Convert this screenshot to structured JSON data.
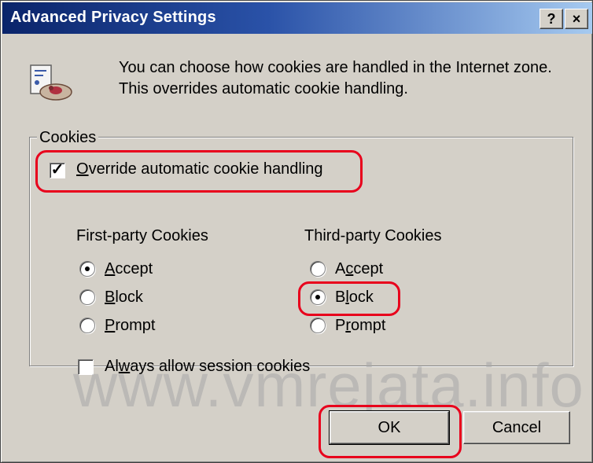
{
  "window": {
    "title": "Advanced Privacy Settings",
    "help_label": "?",
    "close_label": "×"
  },
  "info": {
    "icon": "privacy-cookie-icon",
    "text": "You can choose how cookies are handled in the Internet zone.  This overrides automatic cookie handling."
  },
  "cookies": {
    "legend": "Cookies",
    "override": {
      "label_first": "O",
      "label_rest": "verride automatic cookie handling",
      "checked": true
    },
    "first_party": {
      "heading": "First-party Cookies",
      "options": [
        {
          "pre": "",
          "key": "A",
          "post": "ccept",
          "selected": true
        },
        {
          "pre": "",
          "key": "B",
          "post": "lock",
          "selected": false
        },
        {
          "pre": "",
          "key": "P",
          "post": "rompt",
          "selected": false
        }
      ]
    },
    "third_party": {
      "heading": "Third-party Cookies",
      "options": [
        {
          "pre": "A",
          "key": "c",
          "post": "cept",
          "selected": false
        },
        {
          "pre": "B",
          "key": "l",
          "post": "ock",
          "selected": true
        },
        {
          "pre": "P",
          "key": "r",
          "post": "ompt",
          "selected": false
        }
      ]
    },
    "session": {
      "pre": "Al",
      "key": "w",
      "post": "ays allow session cookies",
      "checked": false
    }
  },
  "buttons": {
    "ok": "OK",
    "cancel": "Cancel"
  },
  "watermark": "www.vmrejata.info",
  "colors": {
    "highlight": "#e8001c",
    "title_start": "#0a246a",
    "title_end": "#a6caf0",
    "dialog_bg": "#d4d0c8"
  }
}
